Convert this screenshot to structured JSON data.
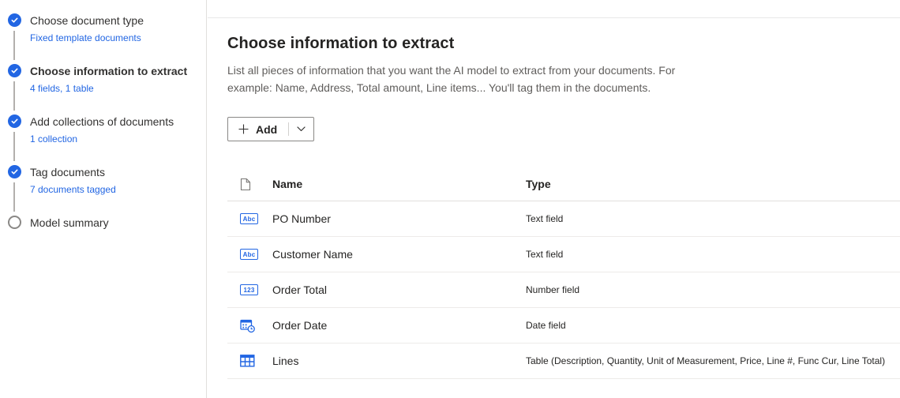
{
  "colors": {
    "accent": "#2266e3",
    "step_connector": "#b3b0ad",
    "divider": "#e1dfdd",
    "row_divider": "#edebe9",
    "title_text": "#252423",
    "body_text": "#605e5c"
  },
  "stepper": {
    "steps": [
      {
        "label": "Choose document type",
        "sublabel": "Fixed template documents",
        "state": "completed"
      },
      {
        "label": "Choose information to extract",
        "sublabel": "4 fields, 1 table",
        "state": "completed-current"
      },
      {
        "label": "Add collections of documents",
        "sublabel": "1 collection",
        "state": "completed"
      },
      {
        "label": "Tag documents",
        "sublabel": "7 documents tagged",
        "state": "completed"
      },
      {
        "label": "Model summary",
        "sublabel": "",
        "state": "upcoming"
      }
    ]
  },
  "main": {
    "title": "Choose information to extract",
    "description_line1": "List all pieces of information that you want the AI model to extract from your documents. For",
    "description_line2": "example: Name, Address, Total amount, Line items... You'll tag them in the documents.",
    "add_button": {
      "label": "Add"
    },
    "icons": {
      "text_badge": "Abc",
      "number_badge": "123"
    },
    "table": {
      "columns": {
        "name": "Name",
        "type": "Type"
      },
      "rows": [
        {
          "icon": "text-field-icon",
          "name": "PO Number",
          "type": "Text field"
        },
        {
          "icon": "text-field-icon",
          "name": "Customer Name",
          "type": "Text field"
        },
        {
          "icon": "number-field-icon",
          "name": "Order Total",
          "type": "Number field"
        },
        {
          "icon": "date-field-icon",
          "name": "Order Date",
          "type": "Date field"
        },
        {
          "icon": "table-icon",
          "name": "Lines",
          "type": "Table (Description, Quantity, Unit of Measurement, Price, Line #, Func Cur, Line Total)"
        }
      ]
    }
  }
}
